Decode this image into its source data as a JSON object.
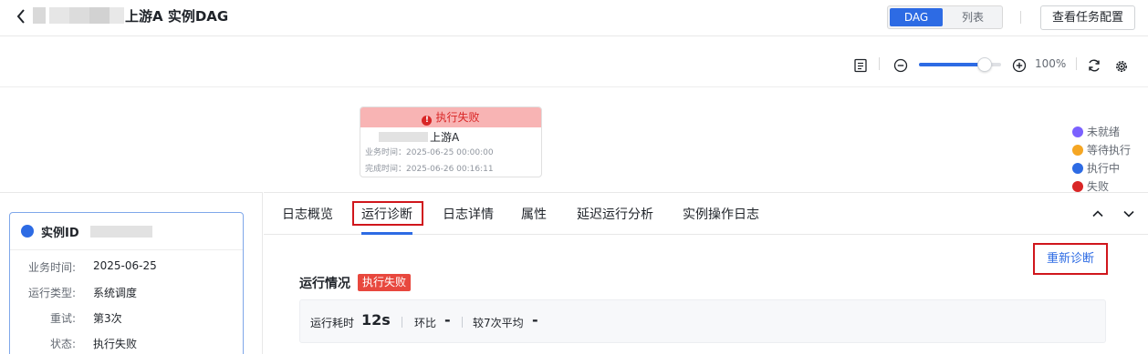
{
  "header": {
    "title": "上游A 实例DAG",
    "view_toggle": {
      "dag_label": "DAG",
      "list_label": "列表"
    },
    "config_button": "查看任务配置"
  },
  "toolbar": {
    "zoom_level": "100%",
    "zoom_fraction": 0.8
  },
  "dag_node": {
    "status": "执行失败",
    "name": "上游A",
    "business_time": "业务时间：2025-06-25 00:00:00",
    "finish_time": "完成时间：2025-06-26 00:16:11"
  },
  "legend": [
    {
      "label": "未就绪",
      "color": "#7b61ff",
      "icon": "ellipsis-icon"
    },
    {
      "label": "等待执行",
      "color": "#f5a623",
      "icon": "clock-icon"
    },
    {
      "label": "执行中",
      "color": "#2d6be4",
      "icon": "play-icon"
    },
    {
      "label": "失败",
      "color": "#d92626",
      "icon": "exclamation-icon"
    }
  ],
  "instance_card": {
    "id_label": "实例ID",
    "fields": [
      {
        "label": "业务时间:",
        "value": "2025-06-25"
      },
      {
        "label": "运行类型:",
        "value": "系统调度"
      },
      {
        "label": "重试:",
        "value": "第3次"
      },
      {
        "label": "状态:",
        "value": "执行失败"
      }
    ]
  },
  "tabs": [
    "日志概览",
    "运行诊断",
    "日志详情",
    "属性",
    "延迟运行分析",
    "实例操作日志"
  ],
  "active_tab": 1,
  "diagnosis": {
    "rediagnose_button": "重新诊断",
    "section_title": "运行情况",
    "status_tag": "执行失败",
    "duration_label": "运行耗时",
    "duration_value": "12s",
    "ratio_label": "环比",
    "ratio_value": "-",
    "avg_label": "较7次平均",
    "avg_value": "-"
  },
  "colors": {
    "accent": "#2d6be4",
    "error": "#d92626",
    "highlight_box": "#d0161c"
  }
}
